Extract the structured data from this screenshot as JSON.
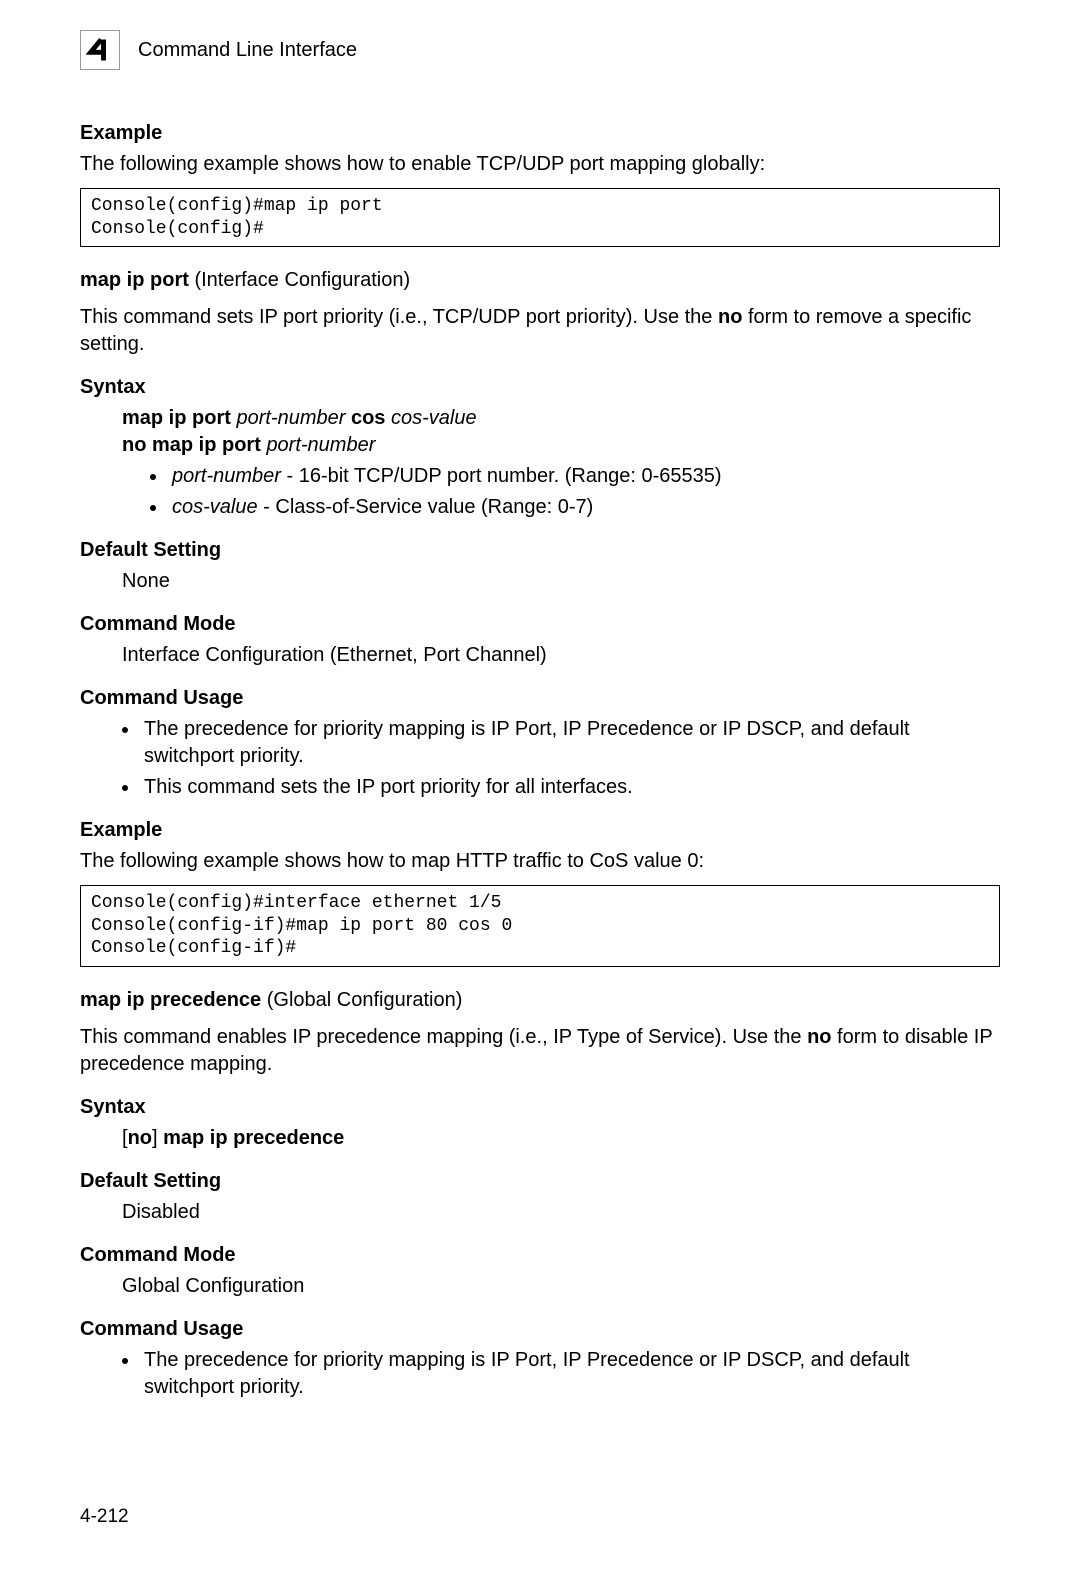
{
  "header": {
    "chapterNumber": "4",
    "title": "Command Line Interface"
  },
  "section1": {
    "heading": "Example",
    "intro": "The following example shows how to enable TCP/UDP port mapping globally:",
    "code": "Console(config)#map ip port\nConsole(config)#"
  },
  "section2": {
    "cmdBold": "map ip port",
    "cmdParen": " (Interface Configuration)",
    "descPrefix": "This command sets IP port priority (i.e., TCP/UDP port priority). Use the ",
    "descBold": "no",
    "descSuffix": " form to remove a specific setting.",
    "syntaxHeading": "Syntax",
    "syntax": {
      "l1_b1": "map ip port ",
      "l1_i1": "port-number",
      "l1_b2": " cos ",
      "l1_i2": "cos-value",
      "l2_b1": "no map ip port ",
      "l2_i1": "port-number"
    },
    "params": [
      {
        "term": "port-number",
        "desc": " - 16-bit TCP/UDP port number. (Range: 0-65535)"
      },
      {
        "term": "cos-value",
        "desc": " - Class-of-Service value (Range: 0-7)"
      }
    ],
    "defaultHeading": "Default Setting",
    "defaultValue": "None",
    "modeHeading": "Command Mode",
    "modeValue": "Interface Configuration (Ethernet, Port Channel)",
    "usageHeading": "Command Usage",
    "usageItems": [
      "The precedence for priority mapping is IP Port, IP Precedence or IP DSCP, and default switchport priority.",
      "This command sets the IP port priority for all interfaces."
    ],
    "exampleHeading": "Example",
    "exampleIntro": "The following example shows how to map HTTP traffic to CoS value 0:",
    "exampleCode": "Console(config)#interface ethernet 1/5\nConsole(config-if)#map ip port 80 cos 0\nConsole(config-if)#"
  },
  "section3": {
    "cmdBold": "map ip precedence",
    "cmdParen": " (Global Configuration)",
    "descPrefix": "This command enables IP precedence mapping (i.e., IP Type of Service). Use the ",
    "descBold": "no",
    "descSuffix": " form to disable IP precedence mapping.",
    "syntaxHeading": "Syntax",
    "syntax": {
      "br1": "[",
      "b1": "no",
      "br2": "] ",
      "b2": "map ip precedence"
    },
    "defaultHeading": "Default Setting",
    "defaultValue": "Disabled",
    "modeHeading": "Command Mode",
    "modeValue": "Global Configuration",
    "usageHeading": "Command Usage",
    "usageItems": [
      "The precedence for priority mapping is IP Port, IP Precedence or IP DSCP, and default switchport priority."
    ]
  },
  "footer": {
    "pageNumber": "4-212"
  }
}
